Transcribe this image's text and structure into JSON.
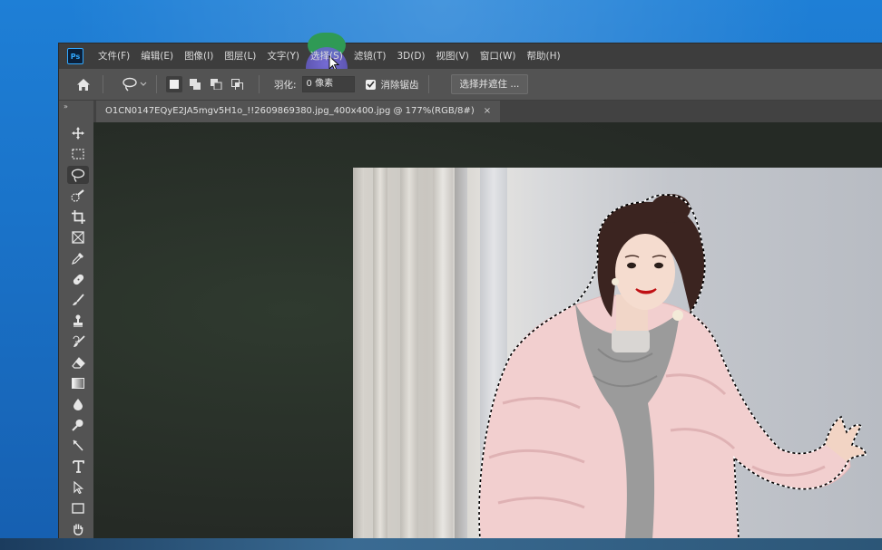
{
  "window": {
    "app_logo_text": "Ps"
  },
  "menu": {
    "items": [
      {
        "label": "文件(F)"
      },
      {
        "label": "编辑(E)"
      },
      {
        "label": "图像(I)"
      },
      {
        "label": "图层(L)"
      },
      {
        "label": "文字(Y)"
      },
      {
        "label": "选择(S)"
      },
      {
        "label": "滤镜(T)"
      },
      {
        "label": "3D(D)"
      },
      {
        "label": "视图(V)"
      },
      {
        "label": "窗口(W)"
      },
      {
        "label": "帮助(H)"
      }
    ],
    "active_item": "选择(S)"
  },
  "options_bar": {
    "feather_label": "羽化:",
    "feather_value": "0 像素",
    "antialias_label": "消除锯齿",
    "antialias_checked": true,
    "select_mask_button": "选择并遮住 ..."
  },
  "toolbar": {
    "collapse_glyph": "»",
    "active_tool": "lasso-tool"
  },
  "document": {
    "tab_title": "O1CN0147EQyE2JA5mgv5H1o_!!2609869380.jpg_400x400.jpg @ 177%(RGB/8#)",
    "close_glyph": "×"
  },
  "colors": {
    "menubar_bg": "#3d3d3d",
    "panel_bg": "#535353",
    "canvas_bg": "#2a2f2a",
    "accent_highlight": "#6c63d9",
    "desktop_blue": "#1a73c9"
  }
}
